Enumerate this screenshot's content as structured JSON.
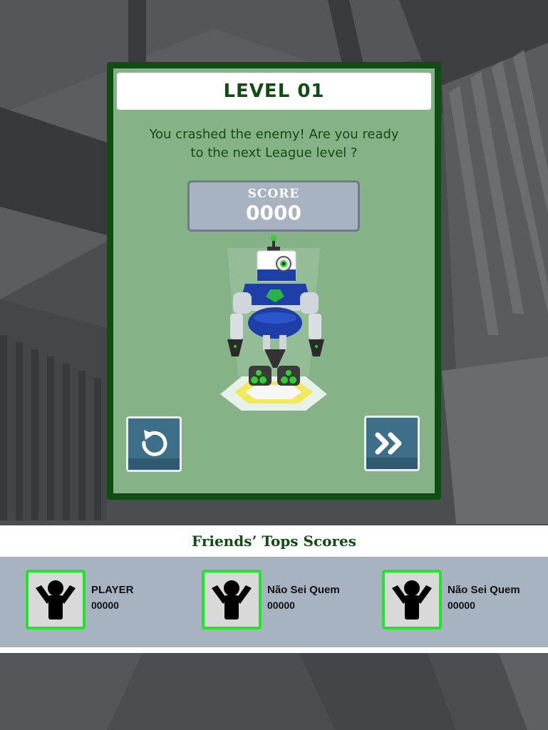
{
  "dialog": {
    "level_title": "LEVEL 01",
    "message_line1": "You crashed the enemy! Are you ready",
    "message_line2": "to the next League level ?",
    "score_label": "SCORE",
    "score_value": "0000"
  },
  "buttons": {
    "retry_icon": "retry-icon",
    "next_icon": "fast-forward-icon"
  },
  "friends": {
    "title": "Friends’ Tops Scores",
    "entries": [
      {
        "name": "PLAYER",
        "score": "00000"
      },
      {
        "name": "Não Sei Quem",
        "score": "00000"
      },
      {
        "name": "Não Sei Quem",
        "score": "00000"
      }
    ]
  },
  "colors": {
    "panel_border": "#0f4d13",
    "panel_fill": "#85b287",
    "avatar_border": "#22e42a",
    "button_fill": "#3d6f89"
  }
}
